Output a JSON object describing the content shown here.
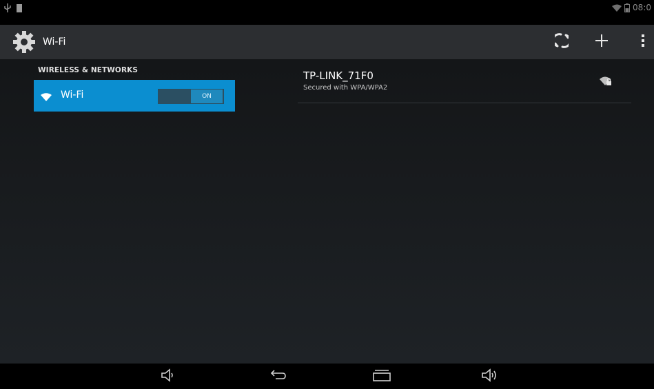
{
  "status_bar": {
    "time": "08:0",
    "icons": [
      "usb-icon",
      "notification-icon",
      "wifi-signal-icon",
      "battery-icon"
    ]
  },
  "action_bar": {
    "title": "Wi-Fi",
    "app_icon": "settings-gear-icon",
    "actions": [
      "wps-icon",
      "add-network-icon",
      "overflow-menu-icon"
    ]
  },
  "sidebar": {
    "section_header": "WIRELESS & NETWORKS",
    "items": [
      {
        "label": "Wi-Fi",
        "icon": "wifi-icon",
        "toggle": "ON",
        "selected": true
      }
    ]
  },
  "networks": [
    {
      "ssid": "TP-LINK_71F0",
      "summary": "Secured with WPA/WPA2",
      "icon": "locked-wifi-signal-icon"
    }
  ],
  "nav_bar": {
    "buttons": [
      "volume-down-icon",
      "back-icon",
      "recents-icon",
      "volume-up-icon"
    ]
  },
  "colors": {
    "accent": "#0b8ed0",
    "action_bar": "#2c2e31",
    "background": "#1a1d20"
  }
}
